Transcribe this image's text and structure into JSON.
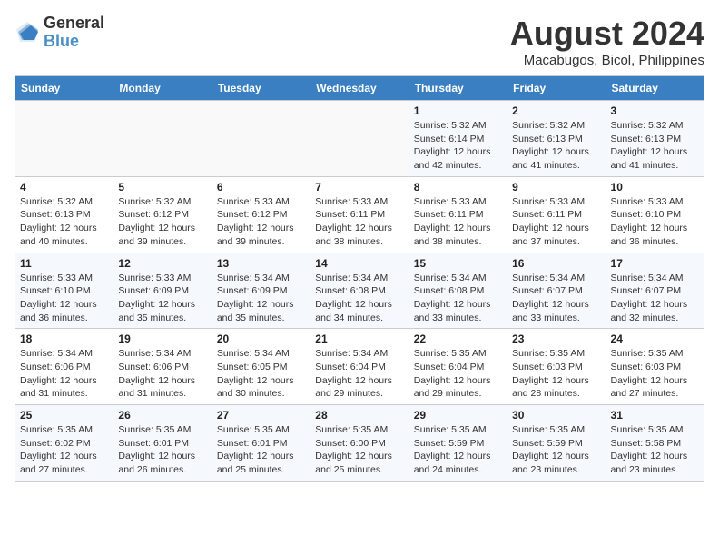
{
  "header": {
    "logo_line1": "General",
    "logo_line2": "Blue",
    "month_year": "August 2024",
    "location": "Macabugos, Bicol, Philippines"
  },
  "weekdays": [
    "Sunday",
    "Monday",
    "Tuesday",
    "Wednesday",
    "Thursday",
    "Friday",
    "Saturday"
  ],
  "weeks": [
    [
      {
        "num": "",
        "info": ""
      },
      {
        "num": "",
        "info": ""
      },
      {
        "num": "",
        "info": ""
      },
      {
        "num": "",
        "info": ""
      },
      {
        "num": "1",
        "info": "Sunrise: 5:32 AM\nSunset: 6:14 PM\nDaylight: 12 hours\nand 42 minutes."
      },
      {
        "num": "2",
        "info": "Sunrise: 5:32 AM\nSunset: 6:13 PM\nDaylight: 12 hours\nand 41 minutes."
      },
      {
        "num": "3",
        "info": "Sunrise: 5:32 AM\nSunset: 6:13 PM\nDaylight: 12 hours\nand 41 minutes."
      }
    ],
    [
      {
        "num": "4",
        "info": "Sunrise: 5:32 AM\nSunset: 6:13 PM\nDaylight: 12 hours\nand 40 minutes."
      },
      {
        "num": "5",
        "info": "Sunrise: 5:32 AM\nSunset: 6:12 PM\nDaylight: 12 hours\nand 39 minutes."
      },
      {
        "num": "6",
        "info": "Sunrise: 5:33 AM\nSunset: 6:12 PM\nDaylight: 12 hours\nand 39 minutes."
      },
      {
        "num": "7",
        "info": "Sunrise: 5:33 AM\nSunset: 6:11 PM\nDaylight: 12 hours\nand 38 minutes."
      },
      {
        "num": "8",
        "info": "Sunrise: 5:33 AM\nSunset: 6:11 PM\nDaylight: 12 hours\nand 38 minutes."
      },
      {
        "num": "9",
        "info": "Sunrise: 5:33 AM\nSunset: 6:11 PM\nDaylight: 12 hours\nand 37 minutes."
      },
      {
        "num": "10",
        "info": "Sunrise: 5:33 AM\nSunset: 6:10 PM\nDaylight: 12 hours\nand 36 minutes."
      }
    ],
    [
      {
        "num": "11",
        "info": "Sunrise: 5:33 AM\nSunset: 6:10 PM\nDaylight: 12 hours\nand 36 minutes."
      },
      {
        "num": "12",
        "info": "Sunrise: 5:33 AM\nSunset: 6:09 PM\nDaylight: 12 hours\nand 35 minutes."
      },
      {
        "num": "13",
        "info": "Sunrise: 5:34 AM\nSunset: 6:09 PM\nDaylight: 12 hours\nand 35 minutes."
      },
      {
        "num": "14",
        "info": "Sunrise: 5:34 AM\nSunset: 6:08 PM\nDaylight: 12 hours\nand 34 minutes."
      },
      {
        "num": "15",
        "info": "Sunrise: 5:34 AM\nSunset: 6:08 PM\nDaylight: 12 hours\nand 33 minutes."
      },
      {
        "num": "16",
        "info": "Sunrise: 5:34 AM\nSunset: 6:07 PM\nDaylight: 12 hours\nand 33 minutes."
      },
      {
        "num": "17",
        "info": "Sunrise: 5:34 AM\nSunset: 6:07 PM\nDaylight: 12 hours\nand 32 minutes."
      }
    ],
    [
      {
        "num": "18",
        "info": "Sunrise: 5:34 AM\nSunset: 6:06 PM\nDaylight: 12 hours\nand 31 minutes."
      },
      {
        "num": "19",
        "info": "Sunrise: 5:34 AM\nSunset: 6:06 PM\nDaylight: 12 hours\nand 31 minutes."
      },
      {
        "num": "20",
        "info": "Sunrise: 5:34 AM\nSunset: 6:05 PM\nDaylight: 12 hours\nand 30 minutes."
      },
      {
        "num": "21",
        "info": "Sunrise: 5:34 AM\nSunset: 6:04 PM\nDaylight: 12 hours\nand 29 minutes."
      },
      {
        "num": "22",
        "info": "Sunrise: 5:35 AM\nSunset: 6:04 PM\nDaylight: 12 hours\nand 29 minutes."
      },
      {
        "num": "23",
        "info": "Sunrise: 5:35 AM\nSunset: 6:03 PM\nDaylight: 12 hours\nand 28 minutes."
      },
      {
        "num": "24",
        "info": "Sunrise: 5:35 AM\nSunset: 6:03 PM\nDaylight: 12 hours\nand 27 minutes."
      }
    ],
    [
      {
        "num": "25",
        "info": "Sunrise: 5:35 AM\nSunset: 6:02 PM\nDaylight: 12 hours\nand 27 minutes."
      },
      {
        "num": "26",
        "info": "Sunrise: 5:35 AM\nSunset: 6:01 PM\nDaylight: 12 hours\nand 26 minutes."
      },
      {
        "num": "27",
        "info": "Sunrise: 5:35 AM\nSunset: 6:01 PM\nDaylight: 12 hours\nand 25 minutes."
      },
      {
        "num": "28",
        "info": "Sunrise: 5:35 AM\nSunset: 6:00 PM\nDaylight: 12 hours\nand 25 minutes."
      },
      {
        "num": "29",
        "info": "Sunrise: 5:35 AM\nSunset: 5:59 PM\nDaylight: 12 hours\nand 24 minutes."
      },
      {
        "num": "30",
        "info": "Sunrise: 5:35 AM\nSunset: 5:59 PM\nDaylight: 12 hours\nand 23 minutes."
      },
      {
        "num": "31",
        "info": "Sunrise: 5:35 AM\nSunset: 5:58 PM\nDaylight: 12 hours\nand 23 minutes."
      }
    ]
  ]
}
